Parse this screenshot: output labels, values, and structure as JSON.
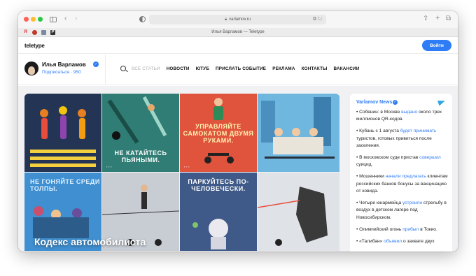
{
  "browser": {
    "url": "varlamov.ru",
    "tab_title": "Илья Варламов — Teletype"
  },
  "site": {
    "logo": "teletype",
    "login_label": "Войти"
  },
  "blog": {
    "author_name": "Илья Варламов",
    "subscribe_text": "Подписаться · 950",
    "nav": [
      "ВСЕ СТАТЬИ",
      "НОВОСТИ",
      "ЮТУБ",
      "ПРИСЛАТЬ СОБЫТИЕ",
      "РЕКЛАМА",
      "КОНТАКТЫ",
      "ВАКАНСИИ"
    ]
  },
  "article": {
    "overlay_title": "Кодекс автомобилиста",
    "panels": [
      {
        "label": ""
      },
      {
        "label": "НЕ КАТАЙТЕСЬ ПЬЯНЫМИ."
      },
      {
        "label": "УПРАВЛЯЙТЕ САМОКАТОМ ДВУМЯ РУКАМИ."
      },
      {
        "label": ""
      },
      {
        "label": "НЕ ГОНЯЙТЕ СРЕДИ ТОЛПЫ."
      },
      {
        "label": ""
      },
      {
        "label": "ПАРКУЙТЕСЬ ПО-ЧЕЛОВЕЧЕСКИ."
      },
      {
        "label": ""
      }
    ]
  },
  "news": {
    "channel": "Varlamov News",
    "items": [
      {
        "pre": "• Собянин: в Москве ",
        "link": "выдано",
        "post": " около трех миллионов QR-кодов."
      },
      {
        "pre": "• Кубань с 1 августа ",
        "link": "будет принимать",
        "post": " туристов, готовых привиться после заселения."
      },
      {
        "pre": "• В московском суде пристав ",
        "link": "совершил",
        "post": " суицид."
      },
      {
        "pre": "• Мошенники ",
        "link": "начали предлагать",
        "post": " клиентам российских банков бонусы за вакцинацию от ковида."
      },
      {
        "pre": "• Четыре юнармейца ",
        "link": "устроили",
        "post": " стрельбу в воздух в детском лагере под Новосибирском."
      },
      {
        "pre": "• Олимпийский огонь ",
        "link": "прибыл",
        "post": " в Токио."
      },
      {
        "pre": "• «Талибан» ",
        "link": "объявил",
        "post": " о захвате двух"
      }
    ]
  },
  "colors": {
    "accent": "#2e7cf6",
    "content_bg": "#f1f1f3",
    "telegram": "#2ea7e0"
  }
}
